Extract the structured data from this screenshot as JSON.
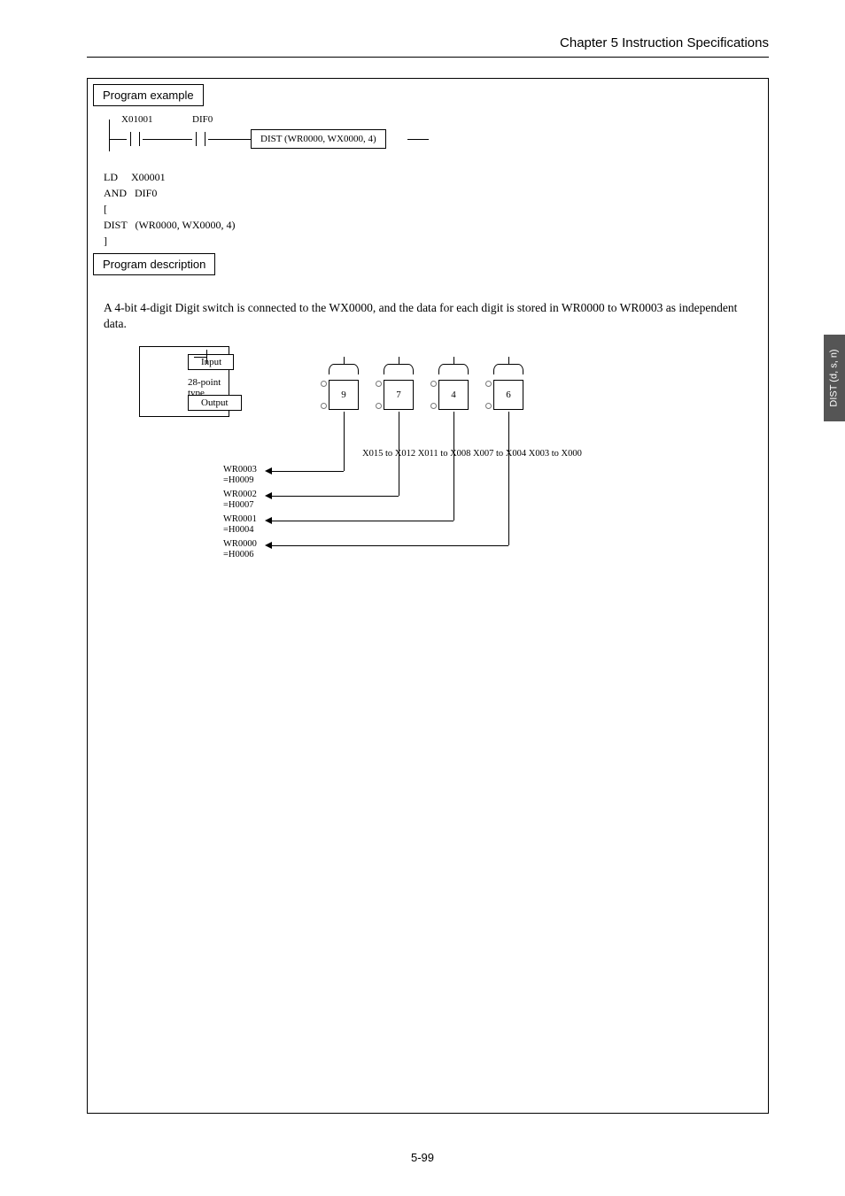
{
  "header": {
    "chapter": "Chapter 5  Instruction Specifications"
  },
  "tab": {
    "label": "DIST (d, s, n)"
  },
  "section": {
    "example": "Program example",
    "description": "Program description"
  },
  "ladder": {
    "contact1": "X01001",
    "contact2": "DIF0",
    "func": "DIST (WR0000, WX0000, 4)"
  },
  "stmt": {
    "l1": "LD     X00001",
    "l2": "AND   DIF0",
    "l3": "[",
    "l4": "DIST   (WR0000, WX0000, 4)",
    "l5": "]"
  },
  "desc": "A 4-bit 4-digit Digit switch is connected to the WX0000, and the data for each digit is stored in WR0000 to WR0003 as independent data.",
  "cpu": {
    "input": "Input",
    "pts": "28-point type",
    "output": "Output"
  },
  "switches": [
    "9",
    "7",
    "4",
    "6"
  ],
  "xrange": "X015 to X012   X011 to X008   X007 to X004  X003 to X000",
  "wr": [
    {
      "a": "WR0003",
      "b": "=H0009"
    },
    {
      "a": "WR0002",
      "b": "=H0007"
    },
    {
      "a": "WR0001",
      "b": "=H0004"
    },
    {
      "a": "WR0000",
      "b": "=H0006"
    }
  ],
  "footer": "5-99"
}
